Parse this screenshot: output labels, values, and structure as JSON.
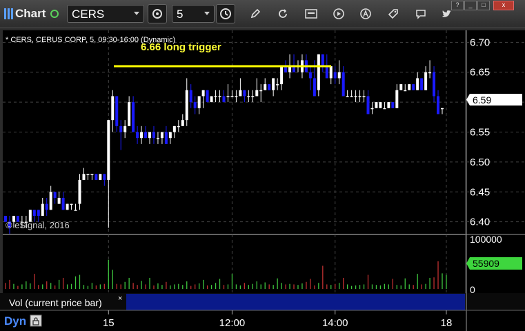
{
  "toolbar": {
    "app_name": "Chart",
    "symbol": "CERS",
    "interval": "5",
    "icons": [
      "link-settings-icon",
      "clock-icon",
      "pencil-icon",
      "refresh-icon",
      "calendar-icon",
      "play-icon",
      "annotation-icon",
      "tag-icon",
      "comment-icon",
      "twitter-icon"
    ],
    "window_controls": [
      "?",
      "_",
      "□",
      "x"
    ]
  },
  "chart": {
    "header": "* CERS, CERUS CORP, 5, 09:30-16:00 (Dynamic)",
    "annotation": "6.66 long trigger",
    "watermark": "© eSignal, 2016",
    "volume_label": "Vol (current price bar)",
    "volume_close": "×",
    "dyn_label": "Dyn",
    "last_price": "6.59",
    "last_volume": "55909",
    "trigger_level": 6.66,
    "colors": {
      "up": "#ffffff",
      "down": "#1a1aff",
      "trigger": "#ffff00",
      "price_tag_bg": "#ffffff",
      "volume_tag_bg": "#3ed63e",
      "vol_up": "#3ec53e",
      "vol_down": "#c03030"
    }
  },
  "chart_data": [
    {
      "type": "candlestick",
      "ylim": [
        6.38,
        6.72
      ],
      "y_ticks": [
        "6.70",
        "6.65",
        "6.60",
        "6.55",
        "6.50",
        "6.45",
        "6.40"
      ],
      "x_ticks": [
        "15",
        "12:00",
        "14:00",
        "18"
      ],
      "candles": [
        [
          6.41,
          6.41,
          6.4,
          6.4
        ],
        [
          6.4,
          6.41,
          6.38,
          6.39
        ],
        [
          6.4,
          6.41,
          6.39,
          6.41
        ],
        [
          6.41,
          6.41,
          6.4,
          6.4
        ],
        [
          6.4,
          6.41,
          6.39,
          6.4
        ],
        [
          6.4,
          6.41,
          6.39,
          6.4
        ],
        [
          6.4,
          6.42,
          6.4,
          6.42
        ],
        [
          6.42,
          6.42,
          6.4,
          6.41
        ],
        [
          6.42,
          6.42,
          6.4,
          6.41
        ],
        [
          6.41,
          6.44,
          6.41,
          6.43
        ],
        [
          6.43,
          6.44,
          6.41,
          6.42
        ],
        [
          6.42,
          6.46,
          6.42,
          6.45
        ],
        [
          6.45,
          6.45,
          6.43,
          6.44
        ],
        [
          6.43,
          6.45,
          6.43,
          6.44
        ],
        [
          6.44,
          6.45,
          6.42,
          6.42
        ],
        [
          6.42,
          6.43,
          6.42,
          6.43
        ],
        [
          6.43,
          6.43,
          6.42,
          6.43
        ],
        [
          6.42,
          6.43,
          6.42,
          6.42
        ],
        [
          6.43,
          6.48,
          6.42,
          6.47
        ],
        [
          6.47,
          6.49,
          6.47,
          6.48
        ],
        [
          6.48,
          6.48,
          6.47,
          6.48
        ],
        [
          6.48,
          6.48,
          6.47,
          6.48
        ],
        [
          6.48,
          6.48,
          6.47,
          6.47
        ],
        [
          6.47,
          6.48,
          6.47,
          6.48
        ],
        [
          6.48,
          6.48,
          6.46,
          6.47
        ],
        [
          6.47,
          6.57,
          6.39,
          6.57
        ],
        [
          6.57,
          6.62,
          6.55,
          6.61
        ],
        [
          6.61,
          6.61,
          6.55,
          6.56
        ],
        [
          6.56,
          6.57,
          6.52,
          6.55
        ],
        [
          6.55,
          6.57,
          6.54,
          6.56
        ],
        [
          6.56,
          6.61,
          6.56,
          6.6
        ],
        [
          6.6,
          6.61,
          6.55,
          6.55
        ],
        [
          6.55,
          6.56,
          6.53,
          6.54
        ],
        [
          6.54,
          6.56,
          6.53,
          6.55
        ],
        [
          6.55,
          6.56,
          6.54,
          6.54
        ],
        [
          6.54,
          6.55,
          6.53,
          6.55
        ],
        [
          6.55,
          6.56,
          6.53,
          6.54
        ],
        [
          6.54,
          6.55,
          6.53,
          6.54
        ],
        [
          6.54,
          6.55,
          6.53,
          6.55
        ],
        [
          6.55,
          6.56,
          6.53,
          6.53
        ],
        [
          6.54,
          6.55,
          6.53,
          6.55
        ],
        [
          6.55,
          6.56,
          6.54,
          6.56
        ],
        [
          6.56,
          6.57,
          6.55,
          6.56
        ],
        [
          6.56,
          6.58,
          6.56,
          6.57
        ],
        [
          6.57,
          6.64,
          6.56,
          6.62
        ],
        [
          6.62,
          6.63,
          6.59,
          6.6
        ],
        [
          6.6,
          6.61,
          6.58,
          6.59
        ],
        [
          6.59,
          6.61,
          6.58,
          6.61
        ],
        [
          6.61,
          6.62,
          6.59,
          6.62
        ],
        [
          6.62,
          6.62,
          6.6,
          6.6
        ],
        [
          6.6,
          6.61,
          6.6,
          6.61
        ],
        [
          6.61,
          6.62,
          6.6,
          6.61
        ],
        [
          6.61,
          6.62,
          6.6,
          6.61
        ],
        [
          6.61,
          6.62,
          6.6,
          6.6
        ],
        [
          6.61,
          6.63,
          6.6,
          6.61
        ],
        [
          6.61,
          6.62,
          6.61,
          6.61
        ],
        [
          6.61,
          6.62,
          6.6,
          6.61
        ],
        [
          6.61,
          6.64,
          6.61,
          6.62
        ],
        [
          6.62,
          6.62,
          6.6,
          6.61
        ],
        [
          6.61,
          6.62,
          6.6,
          6.61
        ],
        [
          6.61,
          6.62,
          6.6,
          6.61
        ],
        [
          6.61,
          6.64,
          6.61,
          6.62
        ],
        [
          6.62,
          6.63,
          6.6,
          6.62
        ],
        [
          6.62,
          6.64,
          6.62,
          6.63
        ],
        [
          6.63,
          6.63,
          6.62,
          6.62
        ],
        [
          6.62,
          6.64,
          6.61,
          6.64
        ],
        [
          6.63,
          6.64,
          6.62,
          6.63
        ],
        [
          6.63,
          6.66,
          6.62,
          6.66
        ],
        [
          6.66,
          6.67,
          6.65,
          6.65
        ],
        [
          6.65,
          6.68,
          6.64,
          6.66
        ],
        [
          6.66,
          6.68,
          6.65,
          6.65
        ],
        [
          6.66,
          6.67,
          6.65,
          6.66
        ],
        [
          6.65,
          6.68,
          6.64,
          6.67
        ],
        [
          6.67,
          6.68,
          6.65,
          6.65
        ],
        [
          6.65,
          6.66,
          6.62,
          6.64
        ],
        [
          6.64,
          6.67,
          6.61,
          6.61
        ],
        [
          6.62,
          6.68,
          6.61,
          6.68
        ],
        [
          6.68,
          6.68,
          6.65,
          6.66
        ],
        [
          6.66,
          6.68,
          6.64,
          6.64
        ],
        [
          6.64,
          6.66,
          6.63,
          6.66
        ],
        [
          6.65,
          6.66,
          6.63,
          6.64
        ],
        [
          6.64,
          6.67,
          6.63,
          6.65
        ],
        [
          6.65,
          6.66,
          6.61,
          6.61
        ],
        [
          6.61,
          6.62,
          6.61,
          6.61
        ],
        [
          6.61,
          6.62,
          6.61,
          6.61
        ],
        [
          6.61,
          6.62,
          6.6,
          6.61
        ],
        [
          6.61,
          6.62,
          6.6,
          6.61
        ],
        [
          6.61,
          6.62,
          6.6,
          6.61
        ],
        [
          6.61,
          6.62,
          6.58,
          6.58
        ],
        [
          6.59,
          6.6,
          6.58,
          6.59
        ],
        [
          6.59,
          6.6,
          6.59,
          6.6
        ],
        [
          6.59,
          6.6,
          6.59,
          6.6
        ],
        [
          6.59,
          6.6,
          6.59,
          6.59
        ],
        [
          6.59,
          6.6,
          6.59,
          6.6
        ],
        [
          6.6,
          6.6,
          6.59,
          6.59
        ],
        [
          6.59,
          6.63,
          6.59,
          6.62
        ],
        [
          6.62,
          6.63,
          6.62,
          6.63
        ],
        [
          6.62,
          6.63,
          6.62,
          6.62
        ],
        [
          6.62,
          6.63,
          6.62,
          6.63
        ],
        [
          6.63,
          6.63,
          6.62,
          6.62
        ],
        [
          6.62,
          6.65,
          6.62,
          6.64
        ],
        [
          6.64,
          6.64,
          6.62,
          6.62
        ],
        [
          6.62,
          6.66,
          6.62,
          6.65
        ],
        [
          6.65,
          6.67,
          6.64,
          6.65
        ],
        [
          6.65,
          6.66,
          6.6,
          6.61
        ],
        [
          6.61,
          6.62,
          6.58,
          6.58
        ],
        [
          6.59,
          6.59,
          6.58,
          6.59
        ]
      ]
    },
    {
      "type": "bar",
      "ylim": [
        0,
        100000
      ],
      "y_ticks": [
        "100000",
        "50000",
        "0"
      ],
      "volumes": [
        12000,
        18000,
        10000,
        6000,
        9000,
        15000,
        11000,
        30000,
        8000,
        9000,
        15000,
        12000,
        7000,
        18000,
        22000,
        9000,
        10000,
        25000,
        28000,
        8000,
        6000,
        12000,
        7000,
        9000,
        10000,
        58000,
        38000,
        10000,
        9000,
        14000,
        22000,
        12000,
        8000,
        16000,
        9000,
        22000,
        7000,
        11000,
        8000,
        14000,
        7000,
        9000,
        10000,
        8000,
        15000,
        6000,
        9000,
        11000,
        18000,
        7000,
        8000,
        12000,
        20000,
        8000,
        9000,
        30000,
        9000,
        7000,
        12000,
        8000,
        10000,
        15000,
        9000,
        13000,
        9000,
        8000,
        21000,
        12000,
        9000,
        10000,
        9000,
        8000,
        11000,
        14000,
        20000,
        7000,
        12000,
        46000,
        9000,
        8000,
        10000,
        12000,
        22000,
        9000,
        6000,
        7000,
        8000,
        9000,
        28000,
        9000,
        8000,
        7000,
        10000,
        9000,
        20000,
        8000,
        7000,
        21000,
        9000,
        8000,
        30000,
        9000,
        10000,
        22000,
        23000,
        55000,
        31000,
        28000
      ]
    }
  ]
}
